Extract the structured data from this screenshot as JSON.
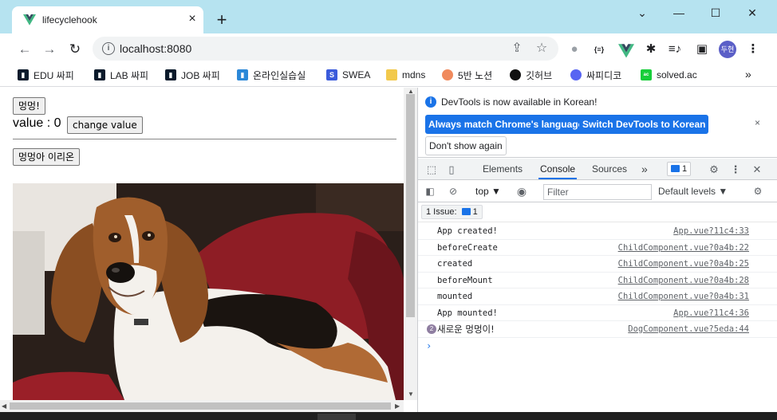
{
  "tab": {
    "title": "lifecyclehook",
    "close": "×",
    "new_tab": "+"
  },
  "window": {
    "minimize": "—",
    "maximize": "☐",
    "close": "✕",
    "dropdown": "⌄"
  },
  "toolbar": {
    "back": "←",
    "forward": "→",
    "reload": "↻",
    "url": "localhost:8080",
    "avatar_text": "두현"
  },
  "bookmarks": [
    {
      "label": "EDU 싸피",
      "icon": "ssafy-icon",
      "color": "#0b1a2b"
    },
    {
      "label": "LAB 싸피",
      "icon": "ssafy-icon",
      "color": "#0b1a2b"
    },
    {
      "label": "JOB 싸피",
      "icon": "ssafy-icon",
      "color": "#0b1a2b"
    },
    {
      "label": "온라인실습실",
      "icon": "ssafy-icon",
      "color": "#2b88d8"
    },
    {
      "label": "SWEA",
      "icon": "swea-icon",
      "color": "#3b5bdb"
    },
    {
      "label": "mdns",
      "icon": "folder-icon",
      "color": "#f2c94c"
    },
    {
      "label": "5반 노션",
      "icon": "peach-icon",
      "color": "#f08a5d"
    },
    {
      "label": "깃허브",
      "icon": "github-icon",
      "color": "#111111"
    },
    {
      "label": "싸피디코",
      "icon": "discord-icon",
      "color": "#5865f2"
    },
    {
      "label": "solved.ac",
      "icon": "solvedac-icon",
      "color": "#17ce3a"
    }
  ],
  "bookmarks_more": "»",
  "page": {
    "bark_button": "멍멍!",
    "value_label": "value : 0",
    "change_button": "change value",
    "dog_button": "멍멍아 이리온"
  },
  "devtools": {
    "info_text": "DevTools is now available in Korean!",
    "btn_match": "Always match Chrome's language",
    "btn_switch": "Switch DevTools to Korean",
    "btn_dont_show": "Don't show again",
    "info_close": "×",
    "tabs": [
      "Elements",
      "Console",
      "Sources"
    ],
    "active_tab": "Console",
    "more_tabs": "»",
    "issues_count": "1",
    "context": "top ▼",
    "filter_placeholder": "Filter",
    "levels": "Default levels ▼",
    "issue_button": "1 Issue:",
    "issue_button_count": "1",
    "accent": "#1a73e8"
  },
  "console_logs": [
    {
      "message": "App created!",
      "source": "App.vue?11c4:33"
    },
    {
      "message": "beforeCreate",
      "source": "ChildComponent.vue?0a4b:22"
    },
    {
      "message": "created",
      "source": "ChildComponent.vue?0a4b:25"
    },
    {
      "message": "beforeMount",
      "source": "ChildComponent.vue?0a4b:28"
    },
    {
      "message": "mounted",
      "source": "ChildComponent.vue?0a4b:31"
    },
    {
      "message": "App mounted!",
      "source": "App.vue?11c4:36"
    },
    {
      "message": "새로운 멍멍이!",
      "source": "DogComponent.vue?5eda:44",
      "repeat": "2"
    }
  ],
  "console_prompt": "›"
}
